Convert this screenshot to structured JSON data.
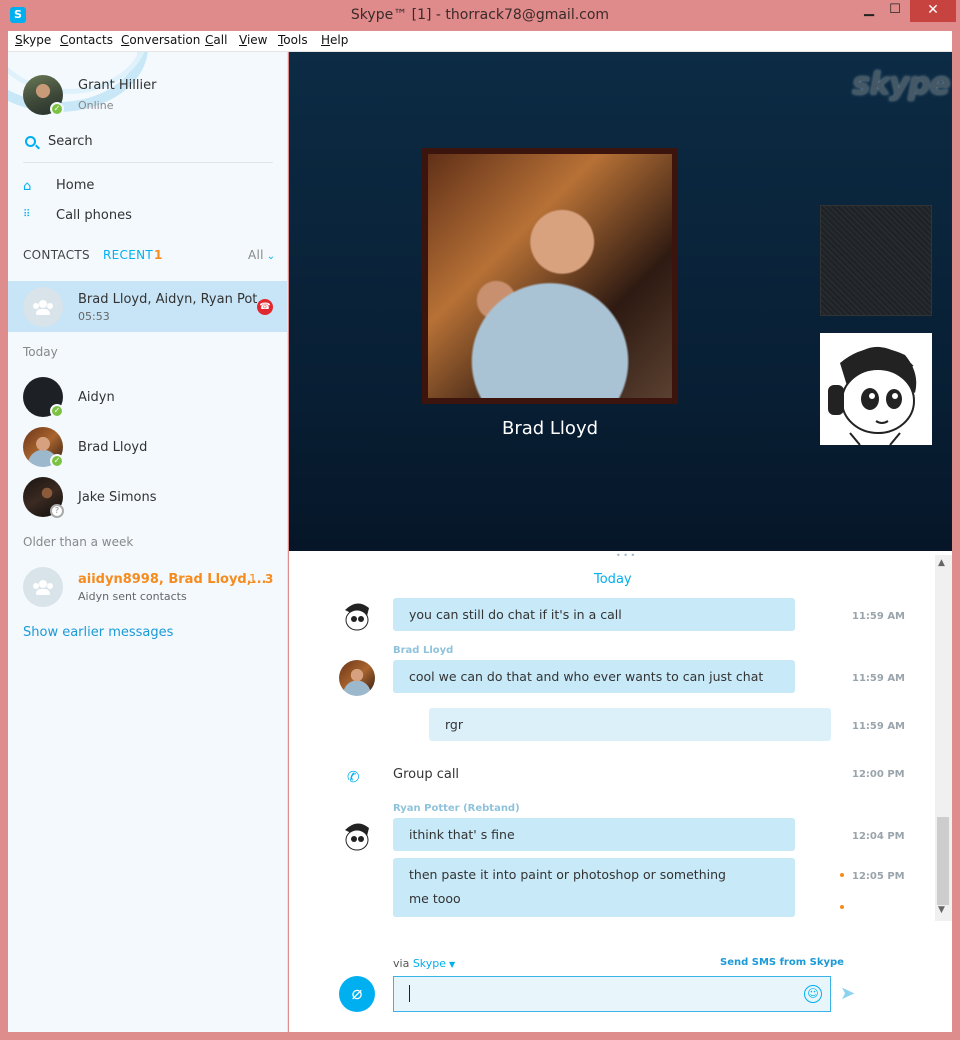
{
  "window": {
    "title": "Skype™ [1] - thorrack78@gmail.com",
    "app_icon": "S",
    "minimize": "▁",
    "maximize": "☐",
    "close": "✕"
  },
  "menu": [
    {
      "accel": "S",
      "rest": "kype"
    },
    {
      "accel": "C",
      "rest": "ontacts"
    },
    {
      "accel": "C",
      "rest": "onversation"
    },
    {
      "accel": "C",
      "rest": "all"
    },
    {
      "accel": "V",
      "rest": "iew"
    },
    {
      "accel": "T",
      "rest": "ools"
    },
    {
      "accel": "H",
      "rest": "elp"
    }
  ],
  "profile": {
    "name": "Grant Hillier",
    "status": "Online",
    "status_color": "#7cc242"
  },
  "sidebar": {
    "search_label": "Search",
    "nav": [
      {
        "icon": "home-icon",
        "label": "Home"
      },
      {
        "icon": "dialpad-icon",
        "label": "Call phones"
      }
    ],
    "tabs": {
      "contacts": "CONTACTS",
      "recent": "RECENT",
      "recent_count": "1",
      "all": "All"
    },
    "active_conversation": {
      "title": "Brad Lloyd, Aidyn, Ryan Pot...",
      "sub": "05:53"
    },
    "today_heading": "Today",
    "today_contacts": [
      {
        "name": "Aidyn",
        "status": "online"
      },
      {
        "name": "Brad Lloyd",
        "status": "online"
      },
      {
        "name": "Jake Simons",
        "status": "unknown"
      }
    ],
    "older_heading": "Older than a week",
    "older_conversation": {
      "title": "aiidyn8998, Brad Lloyd,...",
      "sub": "Aidyn sent contacts",
      "count_a": "1",
      "count_b": "3"
    },
    "show_earlier": "Show earlier messages"
  },
  "video": {
    "logo": "skype",
    "main_participant": "Brad Lloyd"
  },
  "chat": {
    "date_label": "Today",
    "messages": [
      {
        "text": "you can still do chat if it's in a call",
        "time": "11:59 AM"
      },
      {
        "sender": "Brad Lloyd",
        "text": "cool we can do that and who ever wants to can just chat",
        "time": "11:59 AM"
      },
      {
        "text": "rgr",
        "time": "11:59 AM"
      },
      {
        "system": "Group call",
        "time": "12:00 PM"
      },
      {
        "sender": "Ryan Potter (Rebtand)",
        "text": "ithink that' s fine",
        "time": "12:04 PM"
      },
      {
        "text": "then paste it into paint or photoshop or something",
        "text2": "me tooo",
        "time": "12:05 PM"
      }
    ]
  },
  "compose": {
    "via_prefix": "via",
    "via_link": "Skype",
    "sms_link": "Send SMS from Skype",
    "value": ""
  },
  "colors": {
    "accent": "#00aff0",
    "unread": "#f68b1e",
    "frame": "#df8c8c"
  }
}
